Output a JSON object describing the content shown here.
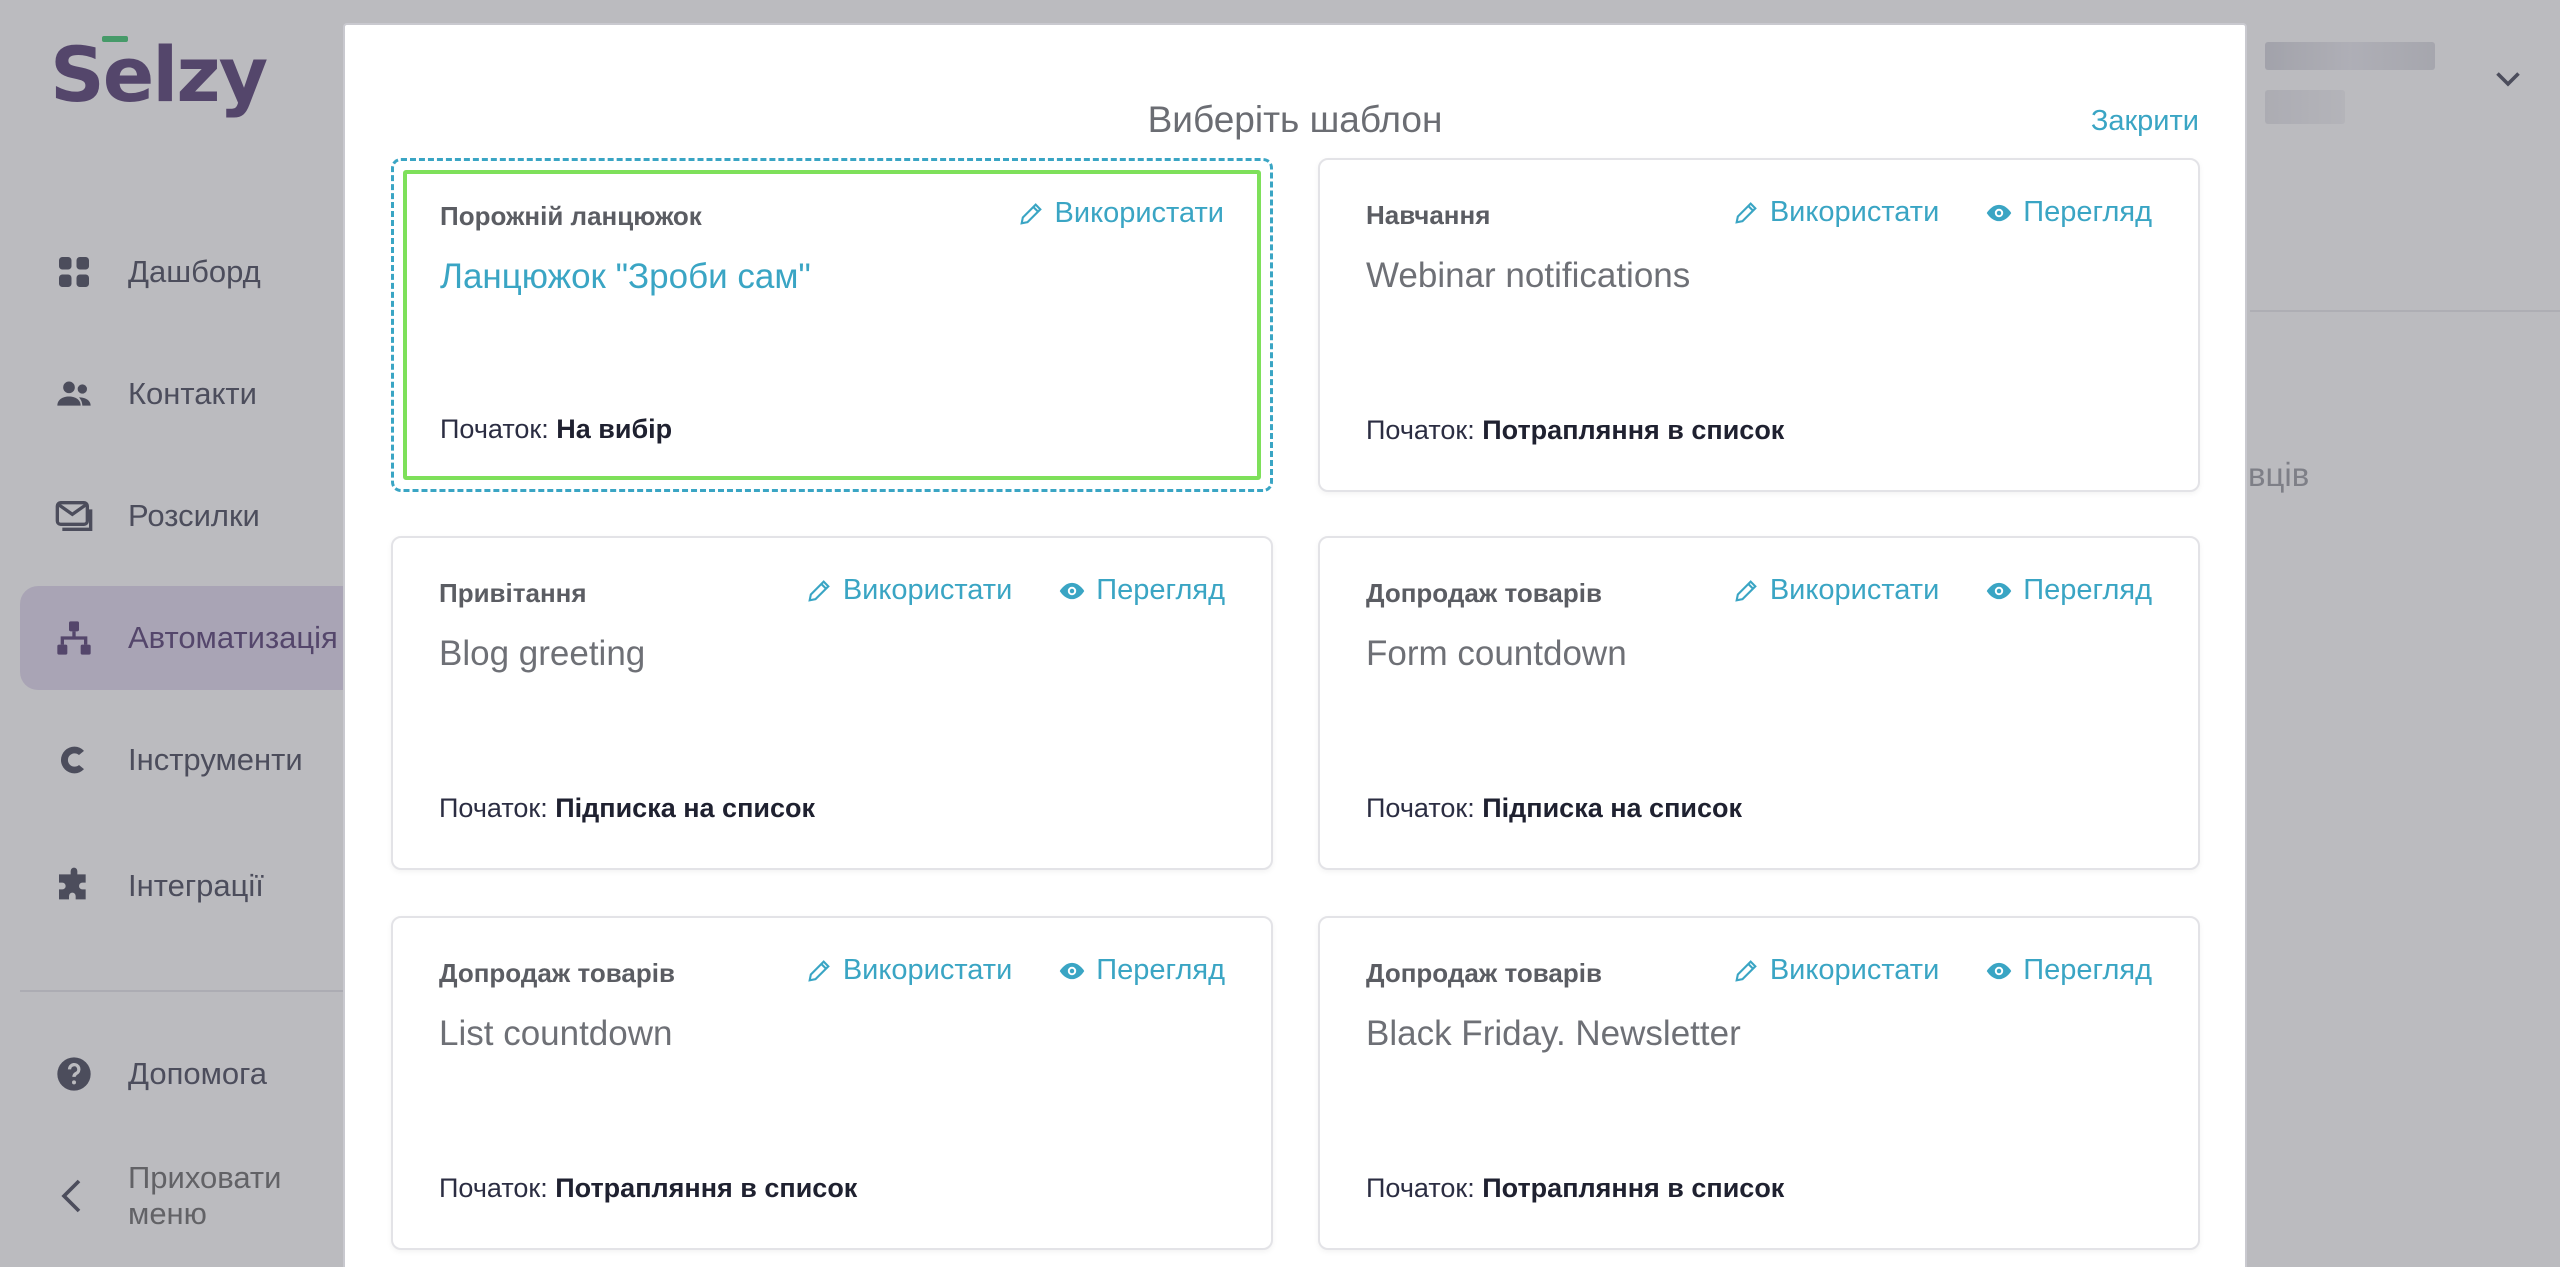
{
  "app": {
    "logo": "Selzy",
    "sidebar": {
      "items": [
        {
          "label": "Дашборд",
          "icon": "dashboard-icon"
        },
        {
          "label": "Контакти",
          "icon": "contacts-icon"
        },
        {
          "label": "Розсилки",
          "icon": "mail-icon"
        },
        {
          "label": "Автоматизація",
          "icon": "automation-icon"
        },
        {
          "label": "Інструменти",
          "icon": "tools-icon"
        },
        {
          "label": "Інтеграції",
          "icon": "puzzle-icon"
        }
      ],
      "help_label": "Допомога",
      "hide_menu_label": "Приховати меню"
    },
    "right_fragment": "вців"
  },
  "modal": {
    "title": "Виберіть шаблон",
    "close_label": "Закрити",
    "use_label": "Використати",
    "preview_label": "Перегляд",
    "start_prefix": "Початок:",
    "cards": [
      {
        "category": "Порожній ланцюжок",
        "title": "Ланцюжок \"Зроби сам\"",
        "start": "На вибір"
      },
      {
        "category": "Навчання",
        "title": "Webinar notifications",
        "start": "Потрапляння в список"
      },
      {
        "category": "Привітання",
        "title": "Blog greeting",
        "start": "Підписка на список"
      },
      {
        "category": "Допродаж товарів",
        "title": "Form countdown",
        "start": "Підписка на список"
      },
      {
        "category": "Допродаж товарів",
        "title": "List countdown",
        "start": "Потрапляння в список"
      },
      {
        "category": "Допродаж товарів",
        "title": "Black Friday. Newsletter",
        "start": "Потрапляння в список"
      }
    ]
  },
  "colors": {
    "accent": "#3aa5c4",
    "brand": "#3b1f5e",
    "highlight": "#7ee05a"
  }
}
